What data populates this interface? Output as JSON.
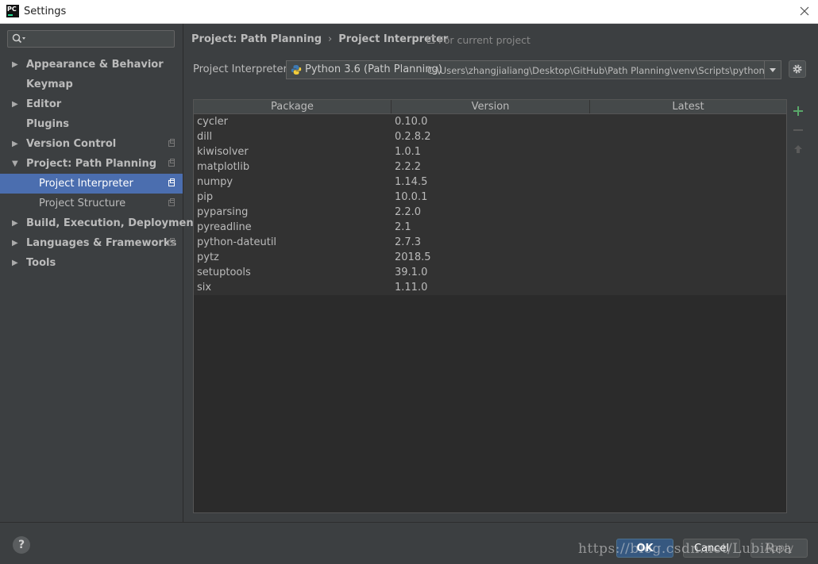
{
  "window": {
    "title": "Settings",
    "app_icon_text": "PC"
  },
  "sidebar": {
    "search_placeholder": "",
    "items": [
      {
        "label": "Appearance & Behavior",
        "expandable": true,
        "expanded": false,
        "bold": true
      },
      {
        "label": "Keymap",
        "expandable": false,
        "bold": true
      },
      {
        "label": "Editor",
        "expandable": true,
        "expanded": false,
        "bold": true
      },
      {
        "label": "Plugins",
        "expandable": false,
        "bold": true
      },
      {
        "label": "Version Control",
        "expandable": true,
        "expanded": false,
        "bold": true,
        "project_icon": true
      },
      {
        "label": "Project: Path Planning",
        "expandable": true,
        "expanded": true,
        "bold": true,
        "project_icon": true
      },
      {
        "label": "Project Interpreter",
        "child": true,
        "selected": true,
        "project_icon": true
      },
      {
        "label": "Project Structure",
        "child": true,
        "project_icon": true
      },
      {
        "label": "Build, Execution, Deployment",
        "expandable": true,
        "expanded": false,
        "bold": true
      },
      {
        "label": "Languages & Frameworks",
        "expandable": true,
        "expanded": false,
        "bold": true,
        "project_icon": true
      },
      {
        "label": "Tools",
        "expandable": true,
        "expanded": false,
        "bold": true
      }
    ]
  },
  "breadcrumb": {
    "parent": "Project: Path Planning",
    "separator": "›",
    "current": "Project Interpreter"
  },
  "scope_note": "For current project",
  "interpreter": {
    "label": "Project Interpreter:",
    "name": "Python 3.6 (Path Planning)",
    "path": "C:\\Users\\zhangjialiang\\Desktop\\GitHub\\Path Planning\\venv\\Scripts\\python.exe"
  },
  "packages": {
    "columns": [
      "Package",
      "Version",
      "Latest"
    ],
    "rows": [
      {
        "package": "cycler",
        "version": "0.10.0",
        "latest": ""
      },
      {
        "package": "dill",
        "version": "0.2.8.2",
        "latest": ""
      },
      {
        "package": "kiwisolver",
        "version": "1.0.1",
        "latest": ""
      },
      {
        "package": "matplotlib",
        "version": "2.2.2",
        "latest": ""
      },
      {
        "package": "numpy",
        "version": "1.14.5",
        "latest": ""
      },
      {
        "package": "pip",
        "version": "10.0.1",
        "latest": ""
      },
      {
        "package": "pyparsing",
        "version": "2.2.0",
        "latest": ""
      },
      {
        "package": "pyreadline",
        "version": "2.1",
        "latest": ""
      },
      {
        "package": "python-dateutil",
        "version": "2.7.3",
        "latest": ""
      },
      {
        "package": "pytz",
        "version": "2018.5",
        "latest": ""
      },
      {
        "package": "setuptools",
        "version": "39.1.0",
        "latest": ""
      },
      {
        "package": "six",
        "version": "1.11.0",
        "latest": ""
      }
    ]
  },
  "footer": {
    "help_label": "?",
    "ok_label": "OK",
    "cancel_label": "Cancel",
    "apply_label": "Apply",
    "watermark": "https://blog.csdn.net/LubiRea"
  },
  "colors": {
    "background": "#3c3f41",
    "selection": "#4b6eaf",
    "table_bg": "#2b2b2b",
    "add_green": "#59a869",
    "ok_blue": "#365880"
  },
  "icons": {
    "search": "search-icon",
    "close": "close-icon",
    "gear": "gear-icon",
    "python": "python-icon",
    "add": "plus-icon",
    "remove": "minus-icon",
    "upgrade": "arrow-up-icon"
  }
}
